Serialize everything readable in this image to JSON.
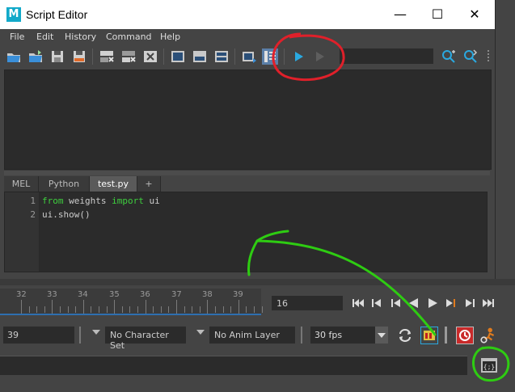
{
  "window": {
    "title": "Script Editor",
    "logo_letter": "M",
    "controls": {
      "minimize": "—",
      "maximize": "☐",
      "close": "✕"
    }
  },
  "menubar": {
    "items": [
      "File",
      "Edit",
      "History",
      "Command",
      "Help"
    ]
  },
  "toolbar": {
    "buttons": [
      "open-script-icon",
      "source-script-icon",
      "save-script-icon",
      "save-script-to-shelf-icon",
      "clear-history-icon",
      "clear-input-icon",
      "clear-all-icon",
      "show-history-only-icon",
      "show-input-only-icon",
      "show-both-icon",
      "echo-all-commands-icon",
      "show-line-numbers-icon",
      "execute-all-icon",
      "execute-selected-icon",
      "search-icon",
      "replace-icon"
    ],
    "search_value": ""
  },
  "tabs": [
    {
      "label": "MEL",
      "active": false
    },
    {
      "label": "Python",
      "active": false
    },
    {
      "label": "test.py",
      "active": true
    },
    {
      "label": "+",
      "active": false
    }
  ],
  "editor": {
    "line_numbers": [
      "1",
      "2"
    ],
    "lines": [
      {
        "kw1": "from",
        "mid": " weights ",
        "kw2": "import",
        "rest": " ui"
      },
      {
        "text": "ui.show()"
      }
    ]
  },
  "timeline": {
    "tick_labels": [
      "32",
      "33",
      "34",
      "35",
      "36",
      "37",
      "38",
      "39"
    ],
    "current_frame": "16"
  },
  "range_controls": {
    "start_frame": "39",
    "character_set": "No Character Set",
    "anim_layer": "No Anim Layer",
    "fps": "30 fps"
  },
  "colors": {
    "accent_blue": "#2e6fb0",
    "annotation_red": "#e0202a",
    "annotation_green": "#2ecc12",
    "keyword_green": "#3ecf3e"
  }
}
